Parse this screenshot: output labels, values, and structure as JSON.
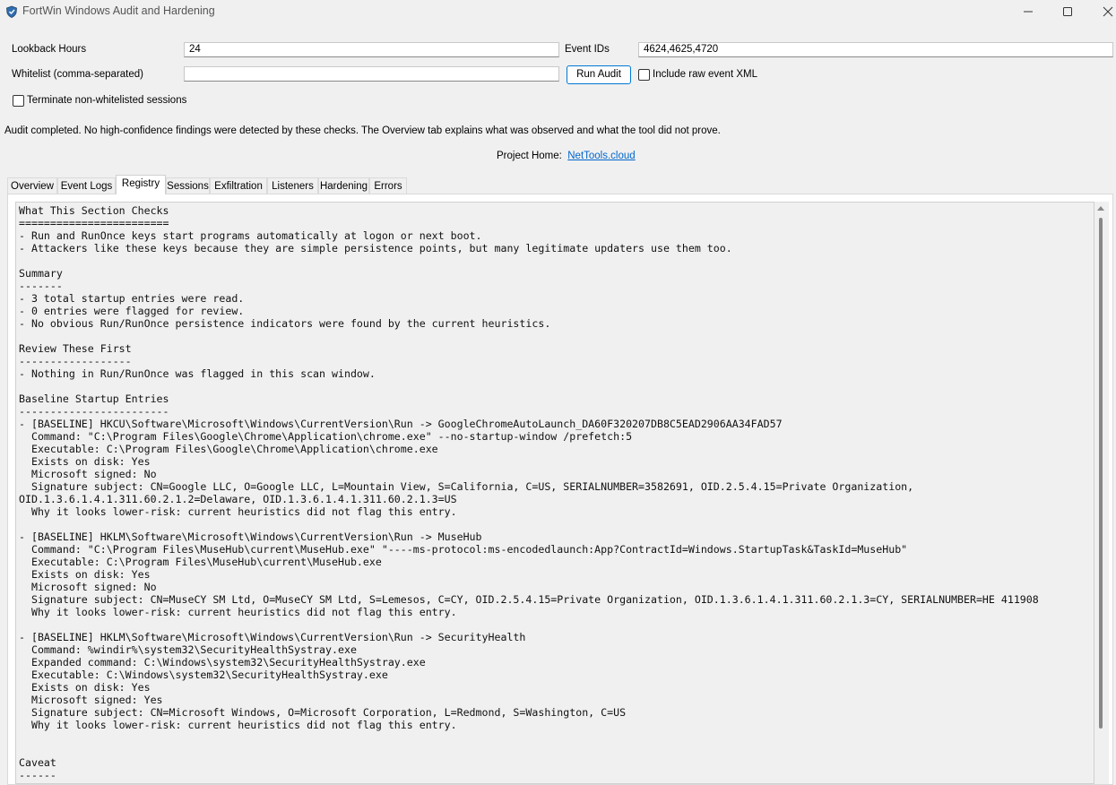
{
  "window": {
    "title": "FortWin Windows Audit and Hardening"
  },
  "form": {
    "lookback_label": "Lookback Hours",
    "lookback_value": "24",
    "event_ids_label": "Event IDs",
    "event_ids_value": "4624,4625,4720",
    "whitelist_label": "Whitelist (comma-separated)",
    "whitelist_value": "",
    "run_audit_label": "Run Audit",
    "include_raw_label": "Include raw event XML",
    "include_raw_checked": false,
    "terminate_label": "Terminate non-whitelisted sessions",
    "terminate_checked": false
  },
  "status_text": "Audit completed. No high-confidence findings were detected by these checks. The Overview tab explains what was observed and what the tool did not prove.",
  "project_home": {
    "label": "Project Home:",
    "link_text": "NetTools.cloud"
  },
  "tabs": [
    {
      "label": "Overview",
      "active": false
    },
    {
      "label": "Event Logs",
      "active": false
    },
    {
      "label": "Registry",
      "active": true
    },
    {
      "label": "Sessions",
      "active": false
    },
    {
      "label": "Exfiltration",
      "active": false
    },
    {
      "label": "Listeners",
      "active": false
    },
    {
      "label": "Hardening",
      "active": false
    },
    {
      "label": "Errors",
      "active": false
    }
  ],
  "report_lines": [
    "What This Section Checks",
    "========================",
    "- Run and RunOnce keys start programs automatically at logon or next boot.",
    "- Attackers like these keys because they are simple persistence points, but many legitimate updaters use them too.",
    "",
    "Summary",
    "-------",
    "- 3 total startup entries were read.",
    "- 0 entries were flagged for review.",
    "- No obvious Run/RunOnce persistence indicators were found by the current heuristics.",
    "",
    "Review These First",
    "------------------",
    "- Nothing in Run/RunOnce was flagged in this scan window.",
    "",
    "Baseline Startup Entries",
    "------------------------",
    "- [BASELINE] HKCU\\Software\\Microsoft\\Windows\\CurrentVersion\\Run -> GoogleChromeAutoLaunch_DA60F320207DB8C5EAD2906AA34FAD57",
    "  Command: \"C:\\Program Files\\Google\\Chrome\\Application\\chrome.exe\" --no-startup-window /prefetch:5",
    "  Executable: C:\\Program Files\\Google\\Chrome\\Application\\chrome.exe",
    "  Exists on disk: Yes",
    "  Microsoft signed: No",
    "  Signature subject: CN=Google LLC, O=Google LLC, L=Mountain View, S=California, C=US, SERIALNUMBER=3582691, OID.2.5.4.15=Private Organization,",
    "OID.1.3.6.1.4.1.311.60.2.1.2=Delaware, OID.1.3.6.1.4.1.311.60.2.1.3=US",
    "  Why it looks lower-risk: current heuristics did not flag this entry.",
    "",
    "- [BASELINE] HKLM\\Software\\Microsoft\\Windows\\CurrentVersion\\Run -> MuseHub",
    "  Command: \"C:\\Program Files\\MuseHub\\current\\MuseHub.exe\" \"----ms-protocol:ms-encodedlaunch:App?ContractId=Windows.StartupTask&TaskId=MuseHub\"",
    "  Executable: C:\\Program Files\\MuseHub\\current\\MuseHub.exe",
    "  Exists on disk: Yes",
    "  Microsoft signed: No",
    "  Signature subject: CN=MuseCY SM Ltd, O=MuseCY SM Ltd, S=Lemesos, C=CY, OID.2.5.4.15=Private Organization, OID.1.3.6.1.4.1.311.60.2.1.3=CY, SERIALNUMBER=HE 411908",
    "  Why it looks lower-risk: current heuristics did not flag this entry.",
    "",
    "- [BASELINE] HKLM\\Software\\Microsoft\\Windows\\CurrentVersion\\Run -> SecurityHealth",
    "  Command: %windir%\\system32\\SecurityHealthSystray.exe",
    "  Expanded command: C:\\Windows\\system32\\SecurityHealthSystray.exe",
    "  Executable: C:\\Windows\\system32\\SecurityHealthSystray.exe",
    "  Exists on disk: Yes",
    "  Microsoft signed: Yes",
    "  Signature subject: CN=Microsoft Windows, O=Microsoft Corporation, L=Redmond, S=Washington, C=US",
    "  Why it looks lower-risk: current heuristics did not flag this entry.",
    "",
    "",
    "Caveat",
    "------"
  ]
}
